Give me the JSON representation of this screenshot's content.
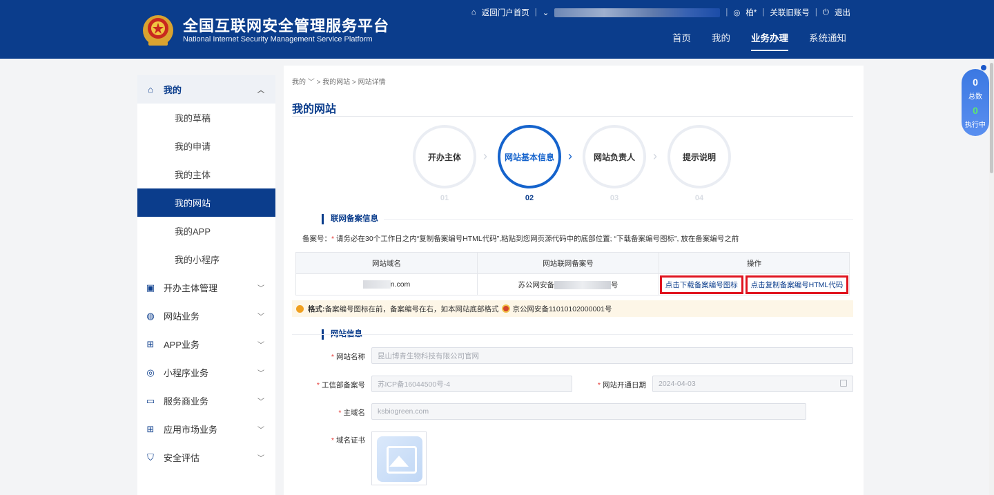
{
  "header": {
    "title_cn": "全国互联网安全管理服务平台",
    "title_en": "National Internet Security Management Service Platform",
    "top_links": {
      "portal": "返回门户首页",
      "user": "柏*",
      "link_account": "关联旧账号",
      "logout": "退出"
    },
    "nav": [
      "首页",
      "我的",
      "业务办理",
      "系统通知"
    ],
    "nav_active": "业务办理"
  },
  "sidebar": {
    "group": "我的",
    "sub_items": [
      "我的草稿",
      "我的申请",
      "我的主体",
      "我的网站",
      "我的APP",
      "我的小程序"
    ],
    "active": "我的网站",
    "main_items": [
      "开办主体管理",
      "网站业务",
      "APP业务",
      "小程序业务",
      "服务商业务",
      "应用市场业务",
      "安全评估"
    ]
  },
  "breadcrumb": {
    "a": "我的",
    "b": "我的网站",
    "c": "网站详情"
  },
  "page_title": "我的网站",
  "steps": [
    {
      "label": "开办主体",
      "num": "01"
    },
    {
      "label": "网站基本信息",
      "num": "02"
    },
    {
      "label": "网站负责人",
      "num": "03"
    },
    {
      "label": "提示说明",
      "num": "04"
    }
  ],
  "section1": {
    "title": "联网备案信息",
    "notice_label": "备案号：",
    "notice_text": "请务必在30个工作日之内“复制备案编号HTML代码”,粘贴到您网页源代码中的底部位置; “下载备案编号图标”, 放在备案编号之前",
    "columns": [
      "网站域名",
      "网站联网备案号",
      "操作"
    ],
    "row": {
      "domain_suffix": "n.com",
      "record_prefix": "苏公网安备",
      "record_suffix": "号"
    },
    "buttons": {
      "download": "点击下载备案编号图标",
      "copy": "点击复制备案编号HTML代码"
    },
    "tip_label": "格式:",
    "tip_text": "备案编号图标在前，备案编号在右，如本网站底部格式",
    "tip_example": "京公网安备11010102000001号"
  },
  "section2": {
    "title": "网站信息",
    "fields": {
      "site_name": {
        "label": "网站名称",
        "value": "昆山博青生物科技有限公司官网"
      },
      "icp": {
        "label": "工信部备案号",
        "value": "苏ICP备16044500号-4"
      },
      "open_date": {
        "label": "网站开通日期",
        "value": "2024-04-03"
      },
      "domain": {
        "label": "主域名",
        "value": "ksbiogreen.com"
      },
      "cert": {
        "label": "域名证书"
      }
    }
  },
  "float_widget": {
    "total": "0",
    "total_label": "总数",
    "running": "0",
    "running_label": "执行中"
  }
}
